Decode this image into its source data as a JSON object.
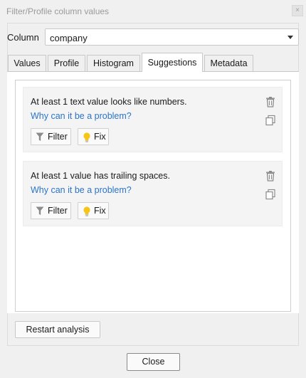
{
  "window": {
    "title": "Filter/Profile column values",
    "close_glyph": "×"
  },
  "column": {
    "label": "Column",
    "selected": "company"
  },
  "tabs": [
    {
      "label": "Values"
    },
    {
      "label": "Profile"
    },
    {
      "label": "Histogram"
    },
    {
      "label": "Suggestions",
      "active": true
    },
    {
      "label": "Metadata"
    }
  ],
  "suggestions": [
    {
      "text": "At least 1 text value looks like numbers.",
      "link": "Why can it be a problem?",
      "filter_label": "Filter",
      "fix_label": "Fix"
    },
    {
      "text": "At least 1 value has trailing spaces.",
      "link": "Why can it be a problem?",
      "filter_label": "Filter",
      "fix_label": "Fix"
    }
  ],
  "restart_label": "Restart analysis",
  "close_label": "Close",
  "icons": {
    "filter": "filter-funnel-icon",
    "fix": "lightbulb-icon",
    "delete": "trash-icon",
    "copy": "copy-icon"
  },
  "colors": {
    "link": "#2b74c8",
    "bulb": "#f5c518"
  }
}
